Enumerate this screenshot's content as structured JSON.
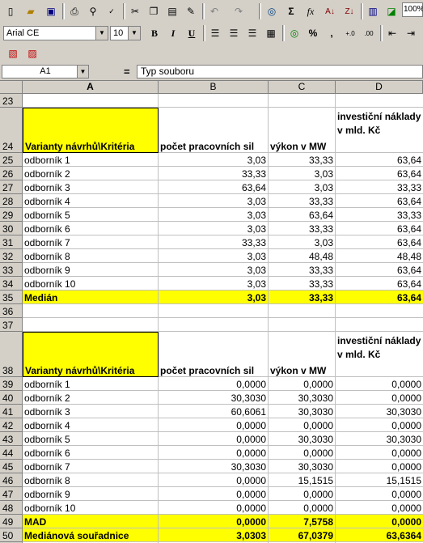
{
  "toolbar": {
    "zoom": "100%",
    "font_name": "Arial CE",
    "font_size": "10",
    "bold": "B",
    "italic": "I",
    "underline": "U",
    "percent": "%",
    "thousands": ",",
    "sum": "Σ",
    "fx": "fx"
  },
  "formula_bar": {
    "name_box": "A1",
    "equals": "=",
    "content": "Typ souboru"
  },
  "columns": [
    "A",
    "B",
    "C",
    "D"
  ],
  "header_rows": [
    24,
    38
  ],
  "table_header": {
    "a": "Varianty návrhů\\Kritéria",
    "b": "počet pracovních sil",
    "c": "výkon v MW",
    "d": "investiční náklady v mld. Kč"
  },
  "rows": [
    {
      "n": "23",
      "a": "",
      "b": "",
      "c": "",
      "d": ""
    },
    {
      "n": "24",
      "header": true
    },
    {
      "n": "25",
      "a": "odborník 1",
      "b": "3,03",
      "c": "33,33",
      "d": "63,64"
    },
    {
      "n": "26",
      "a": "odborník 2",
      "b": "33,33",
      "c": "3,03",
      "d": "63,64"
    },
    {
      "n": "27",
      "a": "odborník 3",
      "b": "63,64",
      "c": "3,03",
      "d": "33,33"
    },
    {
      "n": "28",
      "a": "odborník 4",
      "b": "3,03",
      "c": "33,33",
      "d": "63,64"
    },
    {
      "n": "29",
      "a": "odborník 5",
      "b": "3,03",
      "c": "63,64",
      "d": "33,33"
    },
    {
      "n": "30",
      "a": "odborník 6",
      "b": "3,03",
      "c": "33,33",
      "d": "63,64"
    },
    {
      "n": "31",
      "a": "odborník 7",
      "b": "33,33",
      "c": "3,03",
      "d": "63,64"
    },
    {
      "n": "32",
      "a": "odborník 8",
      "b": "3,03",
      "c": "48,48",
      "d": "48,48"
    },
    {
      "n": "33",
      "a": "odborník 9",
      "b": "3,03",
      "c": "33,33",
      "d": "63,64"
    },
    {
      "n": "34",
      "a": "odborník 10",
      "b": "3,03",
      "c": "33,33",
      "d": "63,64"
    },
    {
      "n": "35",
      "a": "Medián",
      "b": "3,03",
      "c": "33,33",
      "d": "63,64",
      "hl": true
    },
    {
      "n": "36",
      "a": "",
      "b": "",
      "c": "",
      "d": ""
    },
    {
      "n": "37",
      "a": "",
      "b": "",
      "c": "",
      "d": ""
    },
    {
      "n": "38",
      "header": true
    },
    {
      "n": "39",
      "a": "odborník 1",
      "b": "0,0000",
      "c": "0,0000",
      "d": "0,0000"
    },
    {
      "n": "40",
      "a": "odborník 2",
      "b": "30,3030",
      "c": "30,3030",
      "d": "0,0000"
    },
    {
      "n": "41",
      "a": "odborník 3",
      "b": "60,6061",
      "c": "30,3030",
      "d": "30,3030"
    },
    {
      "n": "42",
      "a": "odborník 4",
      "b": "0,0000",
      "c": "0,0000",
      "d": "0,0000"
    },
    {
      "n": "43",
      "a": "odborník 5",
      "b": "0,0000",
      "c": "30,3030",
      "d": "30,3030"
    },
    {
      "n": "44",
      "a": "odborník 6",
      "b": "0,0000",
      "c": "0,0000",
      "d": "0,0000"
    },
    {
      "n": "45",
      "a": "odborník 7",
      "b": "30,3030",
      "c": "30,3030",
      "d": "0,0000"
    },
    {
      "n": "46",
      "a": "odborník 8",
      "b": "0,0000",
      "c": "15,1515",
      "d": "15,1515"
    },
    {
      "n": "47",
      "a": "odborník 9",
      "b": "0,0000",
      "c": "0,0000",
      "d": "0,0000"
    },
    {
      "n": "48",
      "a": "odborník 10",
      "b": "0,0000",
      "c": "0,0000",
      "d": "0,0000"
    },
    {
      "n": "49",
      "a": "MAD",
      "b": "0,0000",
      "c": "7,5758",
      "d": "0,0000",
      "hl": true
    },
    {
      "n": "50",
      "a": "Mediánová souřadnice",
      "b": "3,0303",
      "c": "67,0379",
      "d": "63,6364",
      "hl": true
    },
    {
      "n": "51",
      "a": "",
      "b": "",
      "c": "",
      "d": ""
    }
  ]
}
